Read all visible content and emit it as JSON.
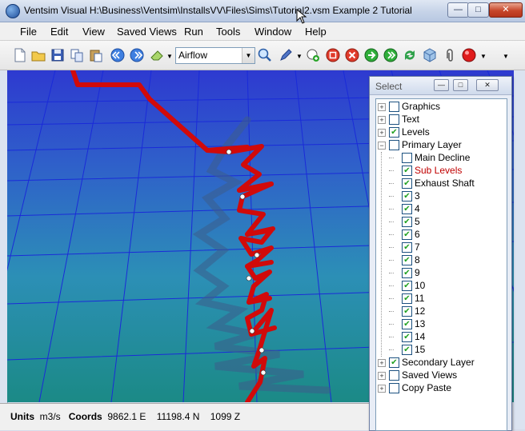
{
  "window": {
    "title": "Ventsim Visual   H:\\Business\\Ventsim\\InstallsVV\\Files\\Sims\\Tutorial2.vsm   Example 2 Tutorial",
    "minimize": "—",
    "maximize": "□",
    "close": "✕"
  },
  "menu": [
    "File",
    "Edit",
    "View",
    "Saved Views",
    "Run",
    "Tools",
    "Window",
    "Help"
  ],
  "toolbar": {
    "display_mode": "Airflow",
    "icons": [
      "new-file-icon",
      "open-folder-icon",
      "save-icon",
      "copy-icon",
      "paste-icon",
      "back-icon",
      "forward-icon",
      "eraser-icon",
      "zoom-icon",
      "edit-pencil-icon",
      "add-node-icon",
      "stop-icon",
      "cancel-icon",
      "go-icon",
      "go-next-icon",
      "recycle-icon",
      "cube-icon",
      "paperclip-icon",
      "record-icon"
    ]
  },
  "status": {
    "units_label": "Units",
    "units_value": "m3/s",
    "coords_label": "Coords",
    "coord_e": "9862.1 E",
    "coord_n": "11198.4 N",
    "coord_z": "1099 Z"
  },
  "select_panel": {
    "title": "Select",
    "minimize": "—",
    "restore": "□",
    "close": "✕",
    "items": [
      {
        "label": "Graphics",
        "checked": false,
        "expander": "+",
        "level": 0
      },
      {
        "label": "Text",
        "checked": false,
        "expander": "+",
        "level": 0
      },
      {
        "label": "Levels",
        "checked": true,
        "expander": "+",
        "level": 0
      },
      {
        "label": "Primary Layer",
        "checked": false,
        "expander": "−",
        "level": 0
      },
      {
        "label": "Main Decline",
        "checked": false,
        "expander": "",
        "level": 1
      },
      {
        "label": "Sub Levels",
        "checked": true,
        "expander": "",
        "level": 1,
        "highlight": true
      },
      {
        "label": "Exhaust Shaft",
        "checked": true,
        "expander": "",
        "level": 1
      },
      {
        "label": "3",
        "checked": true,
        "expander": "",
        "level": 1
      },
      {
        "label": "4",
        "checked": true,
        "expander": "",
        "level": 1
      },
      {
        "label": "5",
        "checked": true,
        "expander": "",
        "level": 1
      },
      {
        "label": "6",
        "checked": true,
        "expander": "",
        "level": 1
      },
      {
        "label": "7",
        "checked": true,
        "expander": "",
        "level": 1
      },
      {
        "label": "8",
        "checked": true,
        "expander": "",
        "level": 1
      },
      {
        "label": "9",
        "checked": true,
        "expander": "",
        "level": 1
      },
      {
        "label": "10",
        "checked": true,
        "expander": "",
        "level": 1
      },
      {
        "label": "11",
        "checked": true,
        "expander": "",
        "level": 1
      },
      {
        "label": "12",
        "checked": true,
        "expander": "",
        "level": 1
      },
      {
        "label": "13",
        "checked": true,
        "expander": "",
        "level": 1
      },
      {
        "label": "14",
        "checked": true,
        "expander": "",
        "level": 1
      },
      {
        "label": "15",
        "checked": true,
        "expander": "",
        "level": 1
      },
      {
        "label": "Secondary Layer",
        "checked": true,
        "expander": "+",
        "level": 0
      },
      {
        "label": "Saved Views",
        "checked": false,
        "expander": "+",
        "level": 0
      },
      {
        "label": "Copy Paste",
        "checked": false,
        "expander": "+",
        "level": 0
      }
    ]
  },
  "colors": {
    "airway": "#d10a0a",
    "grid": "#1a2bd8",
    "highlight_text": "#c00000"
  }
}
